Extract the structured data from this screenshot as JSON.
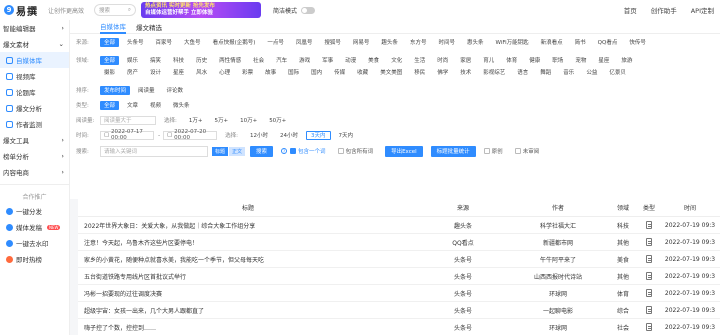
{
  "header": {
    "logo_mark": "9",
    "logo_text": "易撰",
    "slogan": "让创作更高效",
    "search_label": "搜索",
    "promo_line1": "热点资讯 实时更新 抢先发布",
    "promo_line2": "自媒体运营好帮手 立即体验",
    "toggle_label": "简洁模式",
    "nav": [
      "首页",
      "创作助手",
      "API定制"
    ]
  },
  "sidebar": {
    "group1": "智能编辑器",
    "group2": "爆文素材",
    "items": [
      {
        "label": "自媒体库",
        "active": true
      },
      {
        "label": "视频库"
      },
      {
        "label": "论题库"
      },
      {
        "label": "爆文分析"
      },
      {
        "label": "作者监测"
      }
    ],
    "group3": "爆文工具",
    "group4": "榜单分析",
    "group5": "内容电商",
    "coop": "合作推广",
    "promo_items": [
      {
        "label": "一键分发"
      },
      {
        "label": "媒体发稿",
        "badge": "NEW"
      },
      {
        "label": "一键去水印"
      },
      {
        "label": "即时热榜"
      }
    ]
  },
  "tabs": [
    {
      "label": "自媒体库",
      "active": true
    },
    {
      "label": "爆文精选"
    }
  ],
  "filters": {
    "source_label": "来源:",
    "sources": [
      "全部",
      "头条号",
      "百家号",
      "大鱼号",
      "看点快报(企鹅号)",
      "一点号",
      "凤凰号",
      "搜狐号",
      "网易号",
      "趣头条",
      "东方号",
      "时间号",
      "惠头条",
      "WiFi万能钥匙",
      "新浪看点",
      "简书",
      "QQ看点",
      "快传号"
    ],
    "field_label": "领域:",
    "fields_row1": [
      "全部",
      "娱乐",
      "搞笑",
      "科技",
      "历史",
      "两性情感",
      "社会",
      "汽车",
      "游戏",
      "军事",
      "动漫",
      "美食",
      "文化",
      "生活",
      "时尚",
      "家居",
      "育儿",
      "体育",
      "健康",
      "职场",
      "宠物",
      "星座",
      "旅游"
    ],
    "fields_row2": [
      "摄影",
      "房产",
      "设计",
      "星座",
      "风水",
      "心理",
      "彩票",
      "故事",
      "国际",
      "国内",
      "传媒",
      "收藏",
      "美文美图",
      "移民",
      "佛学",
      "技术",
      "影视综艺",
      "语言",
      "舞蹈",
      "音乐",
      "公益",
      "亿景贝"
    ],
    "sort_label": "排序:",
    "sorts": [
      "发布时间",
      "阅读量",
      "评论数"
    ],
    "type_label": "类型:",
    "types": [
      "全部",
      "文章",
      "视频",
      "微头条"
    ],
    "reads_label": "阅读量:",
    "reads_placeholder": "阅读量大于",
    "reads_quick_label": "选择:",
    "reads_quick": [
      "1万+",
      "5万+",
      "10万+",
      "50万+"
    ],
    "time_label": "时间:",
    "time_from": "2022-07-17 00:00",
    "time_to": "2022-07-20 00:00",
    "time_quick_label": "选择:",
    "time_quick": [
      "12小时",
      "24小时",
      "3天内",
      "7天内"
    ],
    "search_label": "搜索:",
    "search_placeholder": "请输入关键词",
    "btn_title": "标题",
    "btn_body": "正文",
    "btn_search": "搜索",
    "include_one": "包含一个词",
    "include_all": "包含所有词",
    "btn_export": "导出Excel",
    "btn_batch": "标题批量统计",
    "original": "原创",
    "unread": "未审阅"
  },
  "table": {
    "headers": {
      "title": "标题",
      "source": "来源",
      "author": "作者",
      "field": "领域",
      "type": "类型",
      "time": "时间"
    },
    "rows": [
      {
        "title": "2022年世界大象日：关爱大象，从我做起｜综合大象工作组分享",
        "source": "趣头条",
        "author": "科学社福大汇",
        "field": "科技",
        "time": "2022-07-19 09:3"
      },
      {
        "title": "注意！今天起，乌鲁木齐这些片区要停电！",
        "source": "QQ看点",
        "author": "新疆都市网",
        "field": "其他",
        "time": "2022-07-19 09:3"
      },
      {
        "title": "家乡的小黄花，随便种点就喜水美，我能吃一个季节，但父母每天吃",
        "source": "头条号",
        "author": "午牛阿平来了",
        "field": "美食",
        "time": "2022-07-19 09:3"
      },
      {
        "title": "五台街道铁路专用线片区首批议式举行",
        "source": "头条号",
        "author": "山西西报时代诗站",
        "field": "其他",
        "time": "2022-07-19 09:3"
      },
      {
        "title": "冯彬一招要现的过往调度决赛",
        "source": "头条号",
        "author": "环球网",
        "field": "体育",
        "time": "2022-07-19 09:3"
      },
      {
        "title": "超级宇宙：女孩一出来，几个大男人跟都直了",
        "source": "头条号",
        "author": "一起聊电影",
        "field": "综合",
        "time": "2022-07-19 09:3"
      },
      {
        "title": "嗨子控了个数，控控到……",
        "source": "头条号",
        "author": "环球网",
        "field": "社会",
        "time": "2022-07-19 09:3"
      }
    ]
  },
  "colors": {
    "accent": "#2f8cff",
    "promo": "#8a44f2"
  }
}
